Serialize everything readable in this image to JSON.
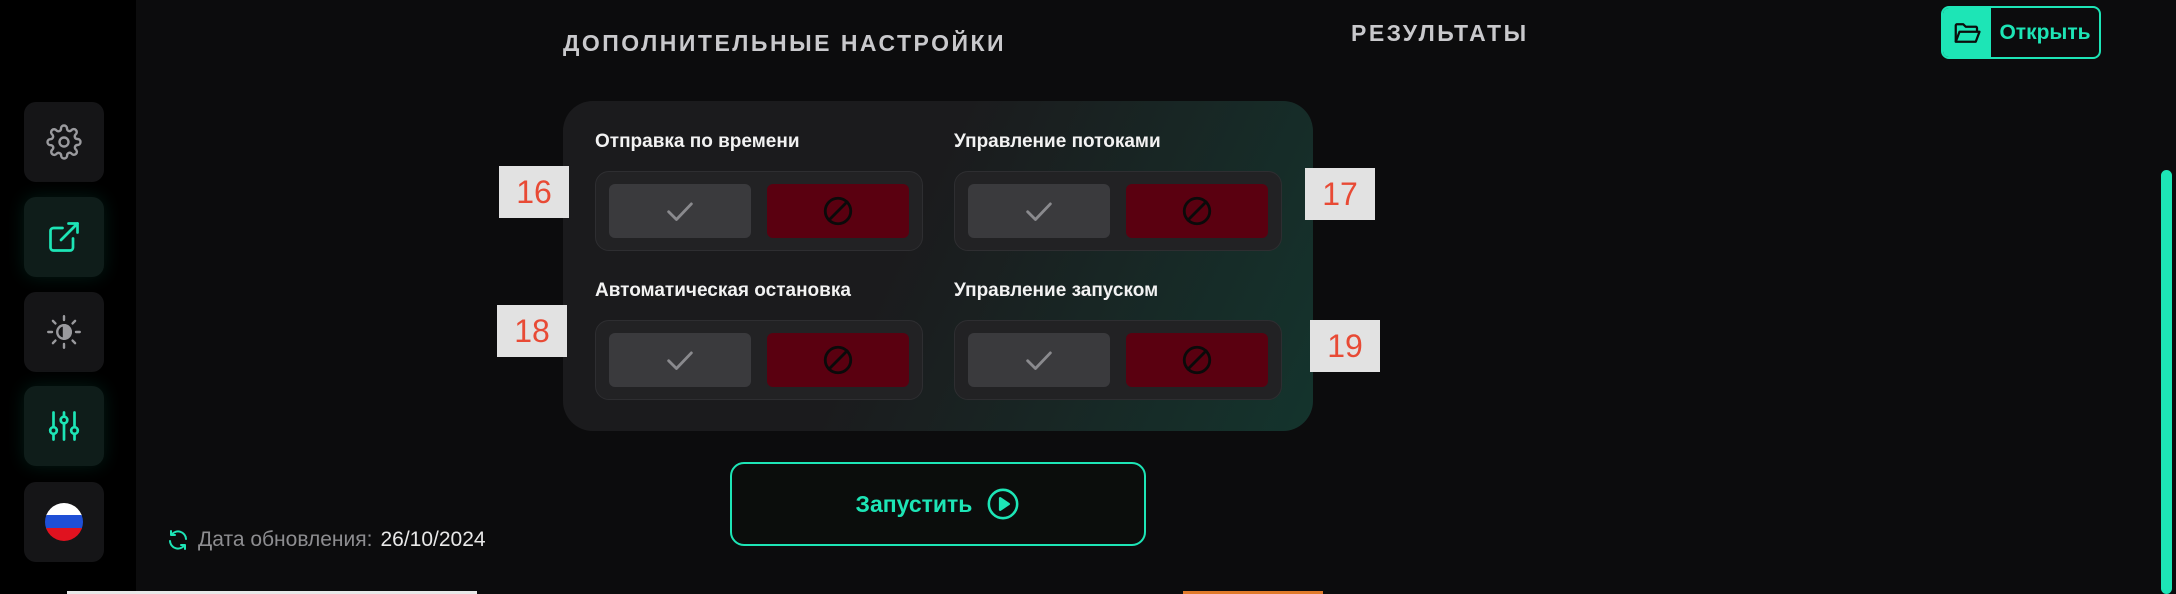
{
  "sidebar": {
    "items": [
      {
        "name": "settings",
        "icon": "gear-icon"
      },
      {
        "name": "open-external",
        "icon": "external-link-icon"
      },
      {
        "name": "theme",
        "icon": "sun-moon-icon"
      },
      {
        "name": "filters",
        "icon": "sliders-icon"
      },
      {
        "name": "language",
        "icon": "russia-flag-icon"
      }
    ]
  },
  "header": {
    "advanced_title": "ДОПОЛНИТЕЛЬНЫЕ НАСТРОЙКИ",
    "results_title": "РЕЗУЛЬТАТЫ",
    "open_label": "Открыть"
  },
  "settings": {
    "options": [
      {
        "label": "Отправка по времени",
        "badge": "16",
        "state": "disabled"
      },
      {
        "label": "Управление потоками",
        "badge": "17",
        "state": "disabled"
      },
      {
        "label": "Автоматическая остановка",
        "badge": "18",
        "state": "disabled"
      },
      {
        "label": "Управление запуском",
        "badge": "19",
        "state": "disabled"
      }
    ]
  },
  "run": {
    "label": "Запустить"
  },
  "update": {
    "label": "Дата обновления:",
    "date": "26/10/2024"
  },
  "colors": {
    "accent": "#1de5b6",
    "disabled_red": "#5a0010",
    "badge_text": "#e84a35"
  }
}
